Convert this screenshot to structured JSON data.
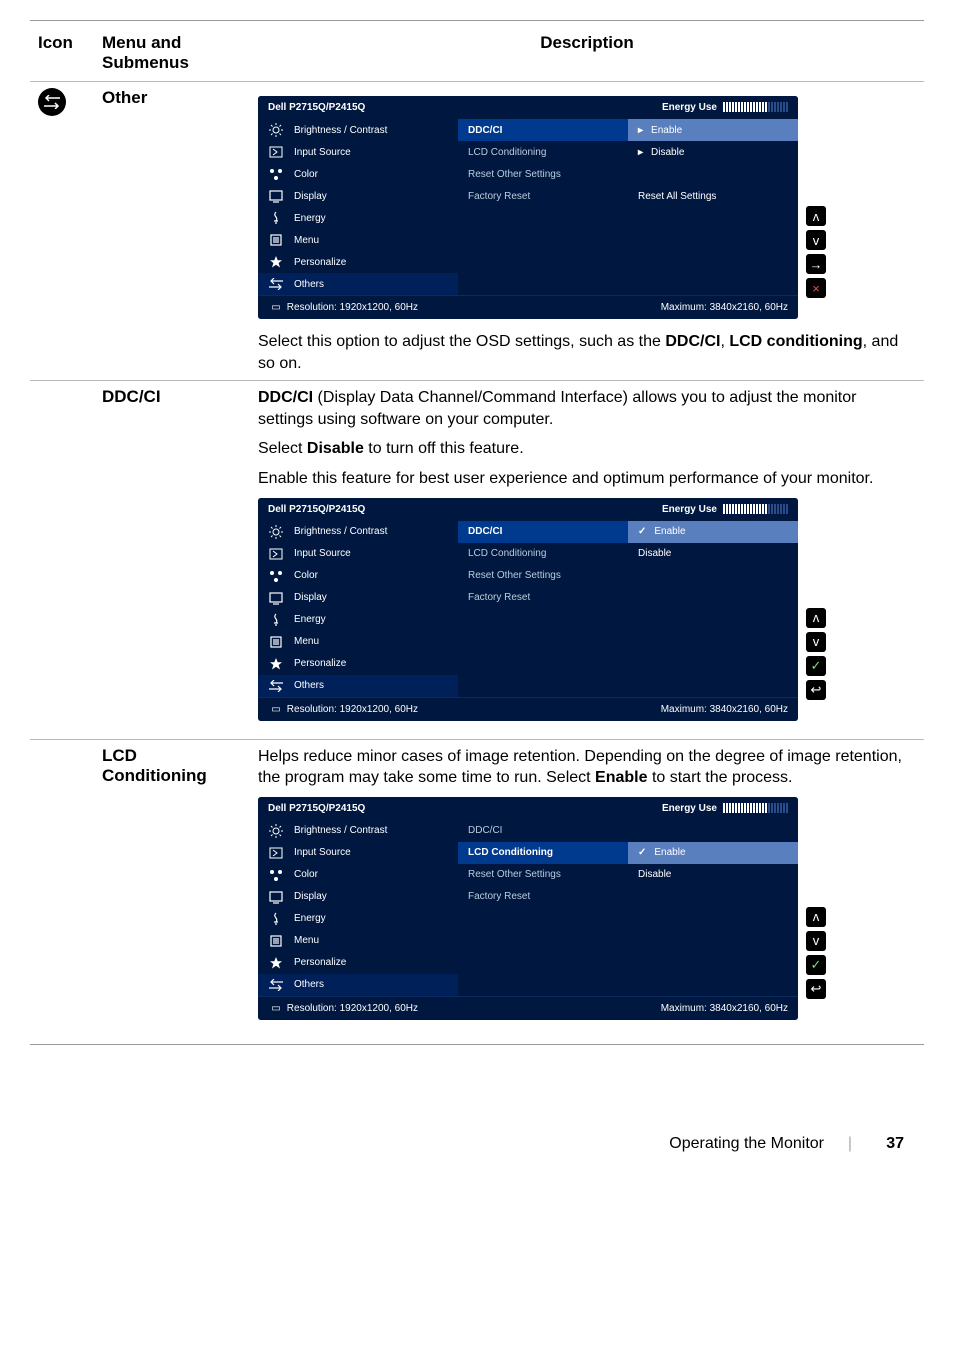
{
  "header": {
    "icon": "Icon",
    "menu": "Menu and Submenus",
    "desc": "Description"
  },
  "rows": {
    "other": {
      "name": "Other",
      "desc_tail": "Select this option to adjust the OSD settings, such as the ",
      "desc_b1": "DDC/CI",
      "desc_mid": ", ",
      "desc_b2": "LCD conditioning",
      "desc_end": ", and so on."
    },
    "ddcci": {
      "name": "DDC/CI",
      "p1a": "DDC/CI",
      "p1b": " (Display Data Channel/Command Interface) allows you to adjust the monitor settings using software on your computer.",
      "p2a": "Select ",
      "p2b": "Disable",
      "p2c": " to turn off this feature.",
      "p3": "Enable this feature for best user experience and optimum performance of your monitor."
    },
    "lcd": {
      "name": "LCD Conditioning",
      "p1a": "Helps reduce minor cases of image retention. Depending on the degree of image retention, the program may take some time to run. Select ",
      "p1b": "Enable",
      "p1c": " to start the process."
    }
  },
  "osd": {
    "title": "Dell P2715Q/P2415Q",
    "energy": "Energy Use",
    "menu": [
      "Brightness / Contrast",
      "Input Source",
      "Color",
      "Display",
      "Energy",
      "Menu",
      "Personalize",
      "Others"
    ],
    "mid": [
      "DDC/CI",
      "LCD Conditioning",
      "Reset Other Settings",
      "Factory Reset"
    ],
    "opt": {
      "enable": "Enable",
      "disable": "Disable",
      "resetall": "Reset All Settings"
    },
    "res": "Resolution: 1920x1200, 60Hz",
    "max": "Maximum: 3840x2160, 60Hz"
  },
  "footer": {
    "title": "Operating the Monitor",
    "page": "37"
  }
}
